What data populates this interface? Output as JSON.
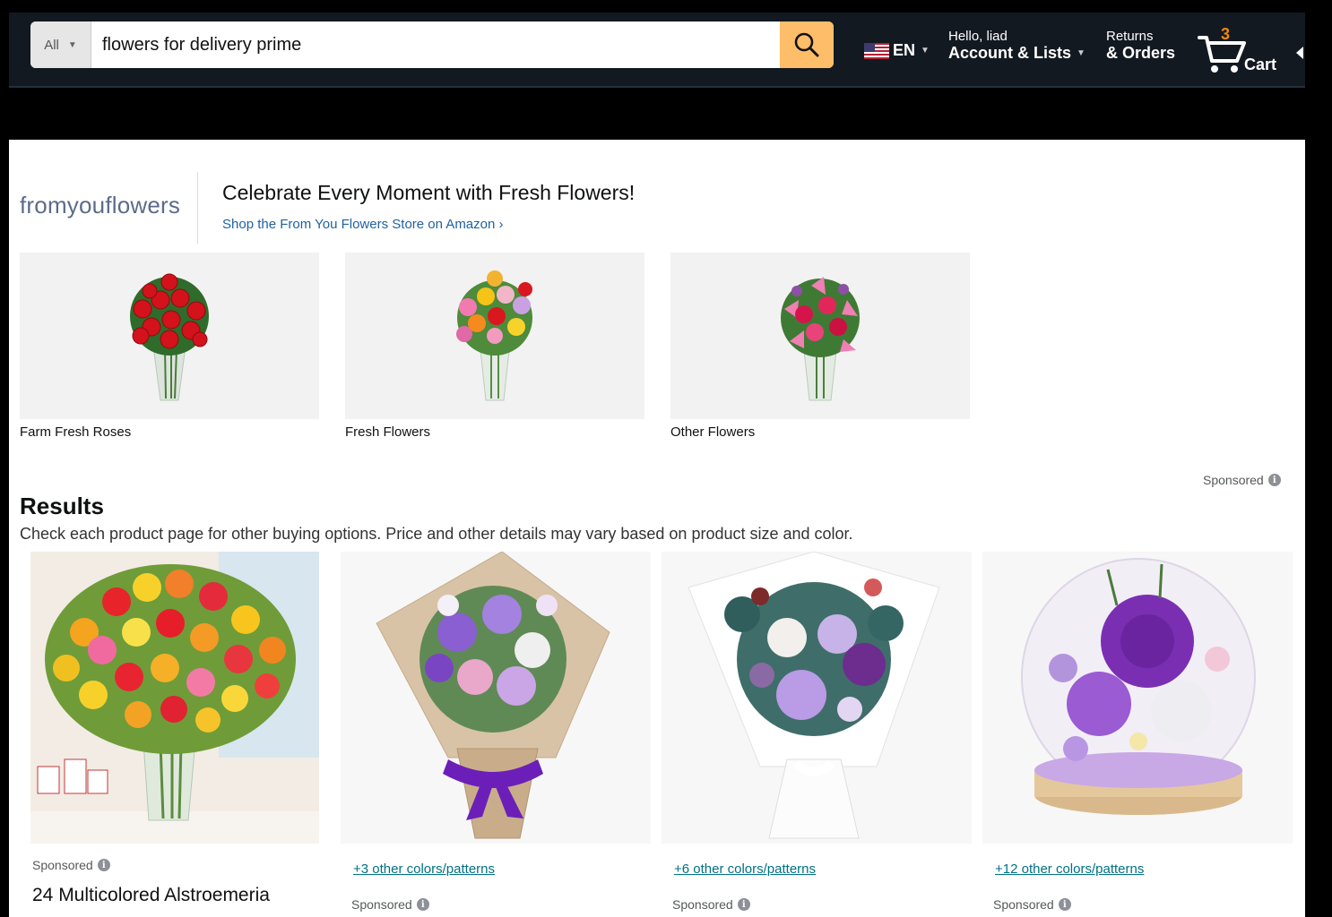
{
  "header": {
    "search": {
      "department": "All",
      "query": "flowers for delivery prime"
    },
    "language": "EN",
    "account": {
      "greeting": "Hello, liad",
      "label": "Account & Lists"
    },
    "returns": {
      "line1": "Returns",
      "line2": "& Orders"
    },
    "cart": {
      "count": "3",
      "label": "Cart"
    }
  },
  "brand": {
    "logo": "fromyouflowers",
    "headline": "Celebrate Every Moment with Fresh Flowers!",
    "link": "Shop the From You Flowers Store on Amazon ›"
  },
  "categories": [
    {
      "label": "Farm Fresh Roses"
    },
    {
      "label": "Fresh Flowers"
    },
    {
      "label": "Other Flowers"
    }
  ],
  "sponsored_label": "Sponsored",
  "results": {
    "heading": "Results",
    "subtitle": "Check each product page for other buying options. Price and other details may vary based on product size and color."
  },
  "products": [
    {
      "title": "24 Multicolored Alstroemeria",
      "sponsored": "Sponsored"
    },
    {
      "variants": "+3 other colors/patterns",
      "sponsored": "Sponsored"
    },
    {
      "variants": "+6 other colors/patterns",
      "sponsored": "Sponsored"
    },
    {
      "variants": "+12 other colors/patterns",
      "sponsored": "Sponsored"
    }
  ],
  "colors": {
    "header_bg": "#131921",
    "search_button": "#febd69",
    "cart_count": "#f08804",
    "link_blue": "#2162a1",
    "variant_link": "#007185"
  }
}
